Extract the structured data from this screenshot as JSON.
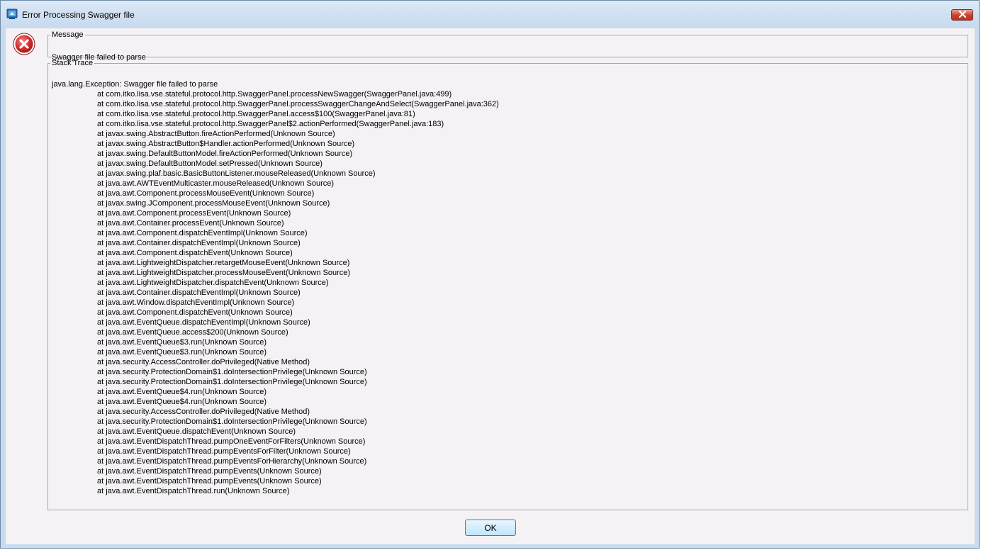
{
  "window": {
    "title": "Error Processing Swagger file"
  },
  "message": {
    "legend": "Message",
    "text": "Swagger file failed to parse"
  },
  "trace": {
    "legend": "Stack Trace",
    "lines": [
      "java.lang.Exception: Swagger file failed to parse",
      "at com.itko.lisa.vse.stateful.protocol.http.SwaggerPanel.processNewSwagger(SwaggerPanel.java:499)",
      "at com.itko.lisa.vse.stateful.protocol.http.SwaggerPanel.processSwaggerChangeAndSelect(SwaggerPanel.java:362)",
      "at com.itko.lisa.vse.stateful.protocol.http.SwaggerPanel.access$100(SwaggerPanel.java:81)",
      "at com.itko.lisa.vse.stateful.protocol.http.SwaggerPanel$2.actionPerformed(SwaggerPanel.java:183)",
      "at javax.swing.AbstractButton.fireActionPerformed(Unknown Source)",
      "at javax.swing.AbstractButton$Handler.actionPerformed(Unknown Source)",
      "at javax.swing.DefaultButtonModel.fireActionPerformed(Unknown Source)",
      "at javax.swing.DefaultButtonModel.setPressed(Unknown Source)",
      "at javax.swing.plaf.basic.BasicButtonListener.mouseReleased(Unknown Source)",
      "at java.awt.AWTEventMulticaster.mouseReleased(Unknown Source)",
      "at java.awt.Component.processMouseEvent(Unknown Source)",
      "at javax.swing.JComponent.processMouseEvent(Unknown Source)",
      "at java.awt.Component.processEvent(Unknown Source)",
      "at java.awt.Container.processEvent(Unknown Source)",
      "at java.awt.Component.dispatchEventImpl(Unknown Source)",
      "at java.awt.Container.dispatchEventImpl(Unknown Source)",
      "at java.awt.Component.dispatchEvent(Unknown Source)",
      "at java.awt.LightweightDispatcher.retargetMouseEvent(Unknown Source)",
      "at java.awt.LightweightDispatcher.processMouseEvent(Unknown Source)",
      "at java.awt.LightweightDispatcher.dispatchEvent(Unknown Source)",
      "at java.awt.Container.dispatchEventImpl(Unknown Source)",
      "at java.awt.Window.dispatchEventImpl(Unknown Source)",
      "at java.awt.Component.dispatchEvent(Unknown Source)",
      "at java.awt.EventQueue.dispatchEventImpl(Unknown Source)",
      "at java.awt.EventQueue.access$200(Unknown Source)",
      "at java.awt.EventQueue$3.run(Unknown Source)",
      "at java.awt.EventQueue$3.run(Unknown Source)",
      "at java.security.AccessController.doPrivileged(Native Method)",
      "at java.security.ProtectionDomain$1.doIntersectionPrivilege(Unknown Source)",
      "at java.security.ProtectionDomain$1.doIntersectionPrivilege(Unknown Source)",
      "at java.awt.EventQueue$4.run(Unknown Source)",
      "at java.awt.EventQueue$4.run(Unknown Source)",
      "at java.security.AccessController.doPrivileged(Native Method)",
      "at java.security.ProtectionDomain$1.doIntersectionPrivilege(Unknown Source)",
      "at java.awt.EventQueue.dispatchEvent(Unknown Source)",
      "at java.awt.EventDispatchThread.pumpOneEventForFilters(Unknown Source)",
      "at java.awt.EventDispatchThread.pumpEventsForFilter(Unknown Source)",
      "at java.awt.EventDispatchThread.pumpEventsForHierarchy(Unknown Source)",
      "at java.awt.EventDispatchThread.pumpEvents(Unknown Source)",
      "at java.awt.EventDispatchThread.pumpEvents(Unknown Source)",
      "at java.awt.EventDispatchThread.run(Unknown Source)"
    ]
  },
  "buttons": {
    "ok_label": "OK"
  },
  "icons": {
    "app": "java-app-icon",
    "error": "error-icon",
    "close": "close-icon"
  },
  "colors": {
    "error_red": "#c8202a",
    "close_red": "#c9402a",
    "frame_blue": "#c9dbee",
    "client_bg": "#f4f2f4"
  }
}
